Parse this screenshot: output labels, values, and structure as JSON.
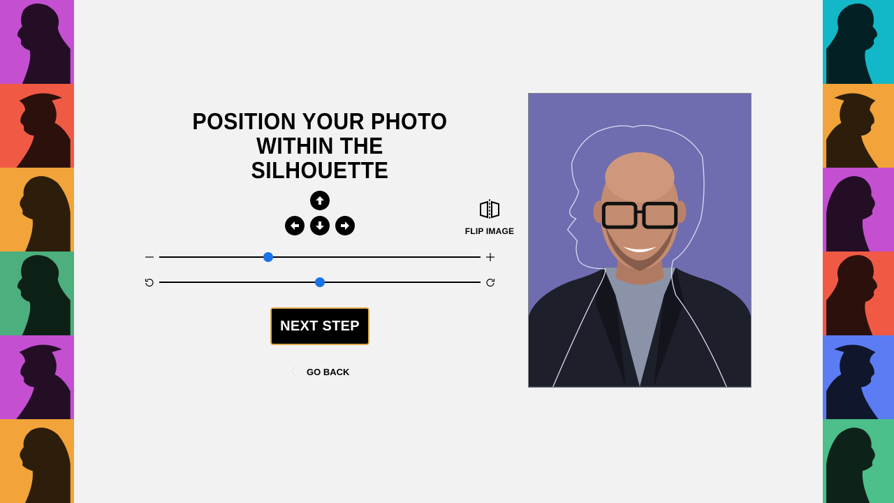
{
  "heading": {
    "line1": "POSITION YOUR PHOTO",
    "line2": "WITHIN THE SILHOUETTE"
  },
  "controls": {
    "arrows": [
      "up-arrow-icon",
      "left-arrow-icon",
      "down-arrow-icon",
      "right-arrow-icon"
    ],
    "flip_label": "FLIP IMAGE",
    "zoom_level": 0.34,
    "rotation_level": 0.5
  },
  "buttons": {
    "next_step": "NEXT STEP",
    "go_back": "GO BACK"
  },
  "colors": {
    "accent": "#1a73e8",
    "button_border": "#e0a94a",
    "photo_background": "#6f6cb0",
    "left_tiles": [
      "#c44fd1",
      "#f05a45",
      "#f2a43a",
      "#4caf7d",
      "#c44fd1",
      "#f2a43a"
    ],
    "right_tiles": [
      "#12b8c7",
      "#f2a43a",
      "#c44fd1",
      "#f05a45",
      "#5b7cf2",
      "#4cbf8a"
    ]
  }
}
